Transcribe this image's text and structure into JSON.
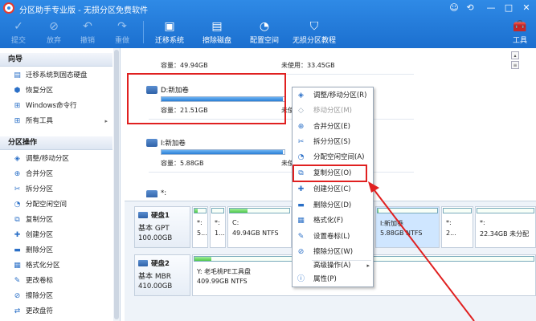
{
  "app": {
    "title": "分区助手专业版 - 无损分区免费软件"
  },
  "window_controls": [
    "☺",
    "⟲",
    "—",
    "□",
    "✕"
  ],
  "toolbar": {
    "items": [
      {
        "label": "提交",
        "icon": "✓"
      },
      {
        "label": "放弃",
        "icon": "⊘"
      },
      {
        "label": "撤销",
        "icon": "↶"
      },
      {
        "label": "重做",
        "icon": "↷"
      },
      {
        "label": "迁移系统",
        "icon": "▣"
      },
      {
        "label": "擦除磁盘",
        "icon": "▤"
      },
      {
        "label": "配置空间",
        "icon": "◔"
      },
      {
        "label": "无损分区教程",
        "icon": "⛉"
      },
      {
        "label": "工具",
        "icon": "🧰"
      }
    ]
  },
  "sidebar": {
    "wizard_title": "向导",
    "wizard_items": [
      {
        "label": "迁移系统到固态硬盘",
        "icon": "▤"
      },
      {
        "label": "恢复分区",
        "icon": "⬢"
      },
      {
        "label": "Windows命令行",
        "icon": "⊞"
      },
      {
        "label": "所有工具",
        "icon": "⊞",
        "arrow": "▸"
      }
    ],
    "ops_title": "分区操作",
    "ops_items": [
      {
        "label": "调整/移动分区",
        "icon": "◈"
      },
      {
        "label": "合并分区",
        "icon": "⊕"
      },
      {
        "label": "拆分分区",
        "icon": "✂"
      },
      {
        "label": "分配空闲空间",
        "icon": "◔"
      },
      {
        "label": "复制分区",
        "icon": "⧉"
      },
      {
        "label": "创建分区",
        "icon": "✚"
      },
      {
        "label": "删除分区",
        "icon": "▬"
      },
      {
        "label": "格式化分区",
        "icon": "▦"
      },
      {
        "label": "更改卷标",
        "icon": "✎"
      },
      {
        "label": "擦除分区",
        "icon": "⊘"
      },
      {
        "label": "更改盘符",
        "icon": "⇄"
      }
    ]
  },
  "partition_list": [
    {
      "name": "",
      "capacity": "容量：49.94GB",
      "free": "未使用：33.45GB",
      "fill": 0
    },
    {
      "name": "D:新加卷",
      "capacity": "容量：21.51GB",
      "free": "未使用：21.40GB",
      "fill": 0.99
    },
    {
      "name": "I:新加卷",
      "capacity": "容量：5.88GB",
      "free": "未使用：5.83GB",
      "fill": 0.99
    },
    {
      "name": "*:",
      "capacity": "",
      "free": "",
      "fill": 0
    }
  ],
  "disks": [
    {
      "name": "硬盘1",
      "type": "基本 GPT",
      "size": "100.00GB",
      "partitions": [
        {
          "l1": "*:",
          "l2": "5...",
          "fill": 0.3
        },
        {
          "l1": "*:",
          "l2": "1...",
          "fill": 0.0
        },
        {
          "l1": "C:",
          "l2": "49.94GB NTFS",
          "fill": 0.3
        },
        {
          "l1": "",
          "l2": "",
          "fill": 0.3
        },
        {
          "l1": "I:新加卷",
          "l2": "5.88GB NTFS",
          "fill": 0.02
        },
        {
          "l1": "*:",
          "l2": "2...",
          "fill": 0.0
        },
        {
          "l1": "*:",
          "l2": "22.34GB 未分配",
          "fill": 0.0
        }
      ]
    },
    {
      "name": "硬盘2",
      "type": "基本 MBR",
      "size": "410.00GB",
      "partitions": [
        {
          "l1": "Y: 老毛桃PE工具盘",
          "l2": "409.99GB NTFS",
          "fill": 0.05
        }
      ]
    }
  ],
  "context_menu": {
    "items": [
      {
        "label": "调整/移动分区(R)",
        "icon": "◈",
        "disabled": false
      },
      {
        "label": "移动分区(M)",
        "icon": "◇",
        "disabled": true
      },
      {
        "label": "合并分区(E)",
        "icon": "⊕",
        "disabled": false
      },
      {
        "label": "拆分分区(S)",
        "icon": "✂",
        "disabled": false
      },
      {
        "label": "分配空闲空间(A)",
        "icon": "◔",
        "disabled": false
      },
      {
        "label": "复制分区(O)",
        "icon": "⧉",
        "disabled": false
      },
      {
        "label": "创建分区(C)",
        "icon": "✚",
        "disabled": false
      },
      {
        "label": "删除分区(D)",
        "icon": "▬",
        "disabled": false
      },
      {
        "label": "格式化(F)",
        "icon": "▦",
        "disabled": false
      },
      {
        "label": "设置卷标(L)",
        "icon": "✎",
        "disabled": false
      },
      {
        "label": "擦除分区(W)",
        "icon": "⊘",
        "disabled": false
      },
      {
        "label": "高级操作(A)",
        "icon": "",
        "disabled": false,
        "arrow": "▸"
      },
      {
        "label": "属性(P)",
        "icon": "ⓘ",
        "disabled": false
      }
    ]
  },
  "colors": {
    "titlebar": "#1b6fcf",
    "highlight": "#e02020",
    "used_bar": "#4fc94a",
    "partition_bar": "#2a7fd6"
  }
}
